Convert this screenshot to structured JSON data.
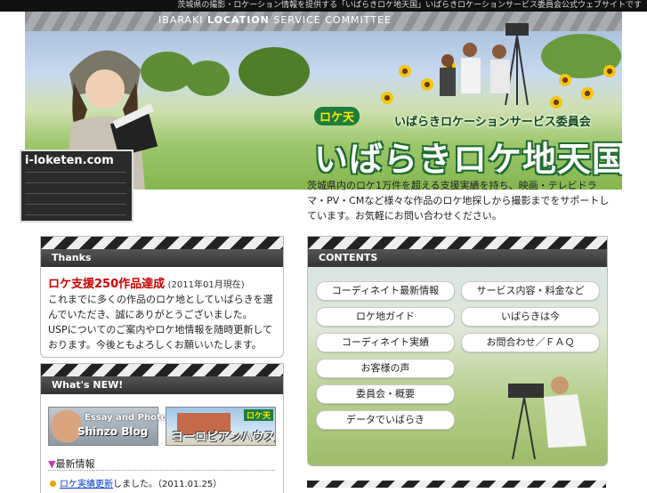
{
  "topbar": {
    "text": "茨城県の撮影・ロケーション情報を提供する「いばらきロケ地天国」いばらきロケーションサービス委員会公式ウェブサイトです"
  },
  "header": {
    "stripe_text_a": "IBARAKI ",
    "stripe_text_b": "LOCATION",
    "stripe_text_c": " SERVICE COMMITTEE",
    "badge_title": "i-loketen.com",
    "logo_tag": "ロケ天",
    "logo_sub": "いばらきロケーションサービス委員会",
    "logo_main": "いばらきロケ地天国"
  },
  "intro": {
    "text": "茨城県内のロケ1万件を超える支援実績を持ち、映画・テレビドラマ・PV・CMなど様々な作品のロケ地探しから撮影までをサポートしています。お気軽にお問い合わせください。"
  },
  "thanks": {
    "heading": "Thanks",
    "title": "ロケ支援250作品達成",
    "date": "(2011年01月現在)",
    "body1": "これまでに多くの作品のロケ地としていばらきを選んでいただき、誠にありがとうございました。",
    "body2": "USPについてのご案内やロケ地情報を随時更新しております。今後ともよろしくお願いいたします。"
  },
  "whatsnew": {
    "heading": "What's NEW!",
    "banner1_line1": "Essay and Photo",
    "banner1_line2": "Shinzo Blog",
    "banner2_tag": "ロケ天",
    "banner2_text": "ヨーロピアンハウス",
    "news_heading": "最新情報",
    "news_link": "ロケ実績更新",
    "news_rest": "しました。（2011.01.25）"
  },
  "contents": {
    "heading": "CONTENTS",
    "buttons": [
      "コーディネイト最新情報",
      "サービス内容・料金など",
      "ロケ地ガイド",
      "いばらきは今",
      "コーディネイト実績",
      "お問合わせ／ＦＡＱ",
      "お客様の声",
      "委員会・概要",
      "データでいばらき"
    ]
  },
  "colors": {
    "accent_red": "#cc0000",
    "logo_green": "#1f7c3c",
    "link_blue": "#0033cc"
  }
}
